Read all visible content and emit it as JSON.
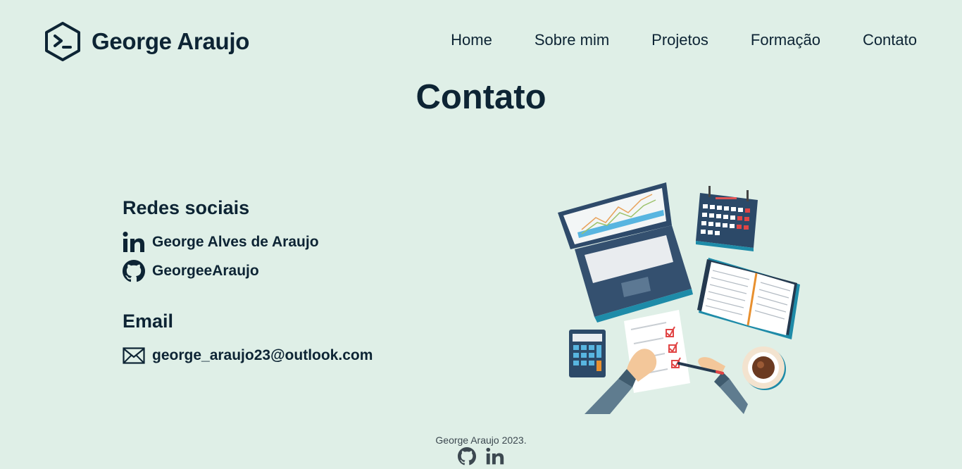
{
  "header": {
    "brand": "George Araujo",
    "nav": [
      "Home",
      "Sobre mim",
      "Projetos",
      "Formação",
      "Contato"
    ]
  },
  "main": {
    "title": "Contato",
    "social": {
      "heading": "Redes sociais",
      "linkedin": "George Alves de Araujo",
      "github": "GeorgeeAraujo"
    },
    "email": {
      "heading": "Email",
      "address": "george_araujo23@outlook.com"
    }
  },
  "footer": {
    "text": "George Araujo 2023."
  },
  "colors": {
    "background": "#dfefe7",
    "text": "#0d2434",
    "footer_text": "#3c4850"
  }
}
